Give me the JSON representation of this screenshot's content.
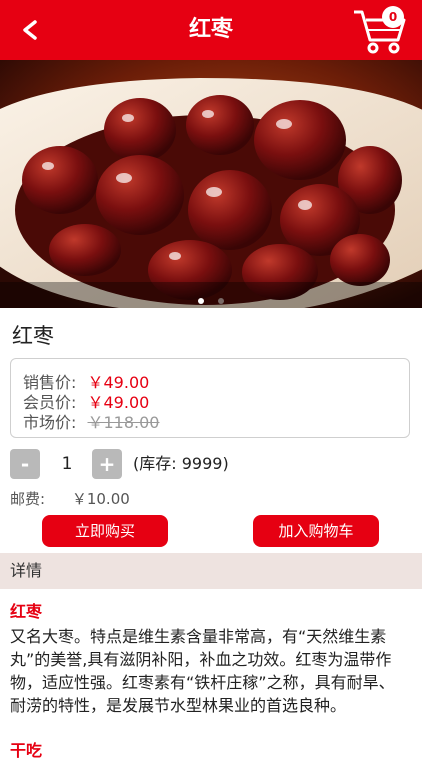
{
  "header": {
    "title": "红枣",
    "cart_count": "0"
  },
  "carousel": {
    "total": 2,
    "active": 0
  },
  "product": {
    "name": "红枣",
    "sale_label": "销售价:",
    "sale_price": "￥49.00",
    "member_label": "会员价:",
    "member_price": "￥49.00",
    "market_label": "市场价:",
    "market_price": "￥118.00"
  },
  "quantity": {
    "minus": "-",
    "value": "1",
    "plus": "+",
    "stock": "(库存:  9999)"
  },
  "shipping": {
    "label": "邮费:",
    "value": "￥10.00"
  },
  "actions": {
    "buy_now": "立即购买",
    "add_cart": "加入购物车"
  },
  "details": {
    "tab": "详情",
    "section1_title": "红枣",
    "section1_body": "又名大枣。特点是维生素含量非常高，有“天然维生素丸”的美誉,具有滋阴补阳，补血之功效。红枣为温带作物，适应性强。红枣素有“铁杆庄稼”之称，具有耐旱、耐涝的特性，是发展节水型林果业的首选良种。",
    "section2_title": "干吃"
  },
  "colors": {
    "brand": "#e60012",
    "detail_bar": "#eee3e0"
  },
  "icons": {
    "back": "chevron-left-icon",
    "cart": "cart-icon"
  }
}
